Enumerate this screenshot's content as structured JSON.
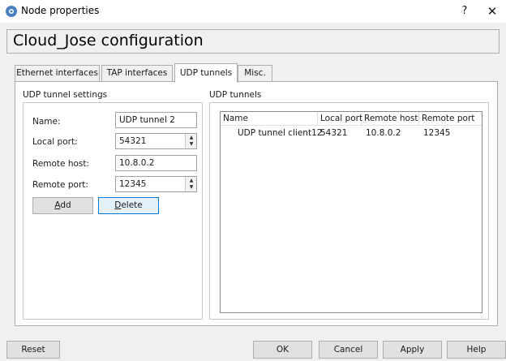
{
  "window": {
    "title": "Node properties",
    "help_glyph": "?",
    "close_glyph": "✕"
  },
  "header": {
    "title": "Cloud_Jose configuration"
  },
  "tabs": [
    {
      "label": "Ethernet interfaces"
    },
    {
      "label": "TAP interfaces"
    },
    {
      "label": "UDP tunnels",
      "active": true
    },
    {
      "label": "Misc."
    }
  ],
  "settings": {
    "group_label": "UDP tunnel settings",
    "name_label": "Name:",
    "name_value": "UDP tunnel 2",
    "local_port_label": "Local port:",
    "local_port_value": "54321",
    "remote_host_label": "Remote host:",
    "remote_host_value": "10.8.0.2",
    "remote_port_label": "Remote port:",
    "remote_port_value": "12345",
    "add_button": {
      "mnemonic": "A",
      "rest": "dd"
    },
    "delete_button": {
      "mnemonic": "D",
      "rest": "elete"
    }
  },
  "tunnels": {
    "group_label": "UDP tunnels",
    "columns": [
      "Name",
      "Local port",
      "Remote host",
      "Remote port"
    ],
    "rows": [
      {
        "name": "UDP tunnel client12",
        "local_port": "54321",
        "remote_host": "10.8.0.2",
        "remote_port": "12345"
      }
    ]
  },
  "footer": {
    "reset": "Reset",
    "ok": "OK",
    "cancel": "Cancel",
    "apply": "Apply",
    "help": "Help"
  },
  "colors": {
    "focus_border": "#0078d7",
    "panel_bg": "#f0f0f0"
  }
}
